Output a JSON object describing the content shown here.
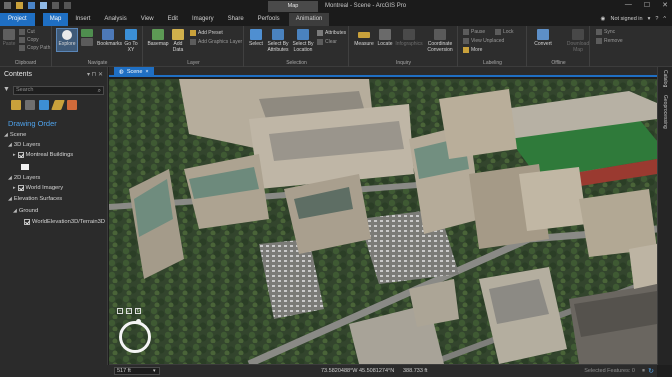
{
  "window": {
    "title": "Montreal - Scene - ArcGIS Pro",
    "context_header": "Map",
    "minimize": "—",
    "maximize": "☐",
    "close": "✕"
  },
  "tabs": [
    "Project",
    "Map",
    "Insert",
    "Analysis",
    "View",
    "Edit",
    "Imagery",
    "Share",
    "Perfools",
    "Animation"
  ],
  "user": {
    "status": "Not signed in",
    "help": "?",
    "minimize_ribbon": "^"
  },
  "ribbon": {
    "clipboard": {
      "label": "Clipboard",
      "paste": "Paste",
      "cut": "Cut",
      "copy": "Copy",
      "copy_path": "Copy Path"
    },
    "navigate": {
      "label": "Navigate",
      "explore": "Explore",
      "bookmarks": "Bookmarks",
      "goto": "Go To XY"
    },
    "layer": {
      "label": "Layer",
      "basemap": "Basemap",
      "add_data": "Add Data",
      "add_preset": "Add Preset",
      "add_graphics": "Add Graphics Layer"
    },
    "selection": {
      "label": "Selection",
      "select": "Select",
      "by_attributes": "Select By Attributes",
      "by_location": "Select By Location",
      "attributes": "Attributes",
      "clear": "Clear"
    },
    "inquiry": {
      "label": "Inquiry",
      "measure": "Measure",
      "locate": "Locate",
      "infographics": "Infographics",
      "coord_conversion": "Coordinate Conversion"
    },
    "labeling": {
      "label": "Labeling",
      "pause": "Pause",
      "lock": "Lock",
      "view_unplaced": "View Unplaced",
      "more": "More"
    },
    "offline": {
      "label": "Offline",
      "convert": "Convert",
      "download_map": "Download Map",
      "sync": "Sync",
      "remove": "Remove"
    }
  },
  "contents": {
    "title": "Contents",
    "pin": "▾ ⊓ ✕",
    "search_placeholder": "Search",
    "drawing_order": "Drawing Order",
    "tree": {
      "scene": "Scene",
      "layers3d": "3D Layers",
      "montreal_buildings": "Montreal Buildings",
      "layers2d": "2D Layers",
      "world_imagery": "World Imagery",
      "elevation": "Elevation Surfaces",
      "ground": "Ground",
      "terrain": "WorldElevation3D/Terrain3D"
    }
  },
  "view": {
    "tab_label": "Scene",
    "close": "×"
  },
  "right_rail": {
    "catalog": "Catalog",
    "geoprocessing": "Geoprocessing"
  },
  "status": {
    "scale": "517 ft",
    "coords": "73.5820488°W 45.5081274°N",
    "elevation": "388.733 ft",
    "selected_features": "Selected Features: 0"
  },
  "colors": {
    "accent": "#1f6fc3",
    "drawing_order": "#4fa3ec"
  }
}
